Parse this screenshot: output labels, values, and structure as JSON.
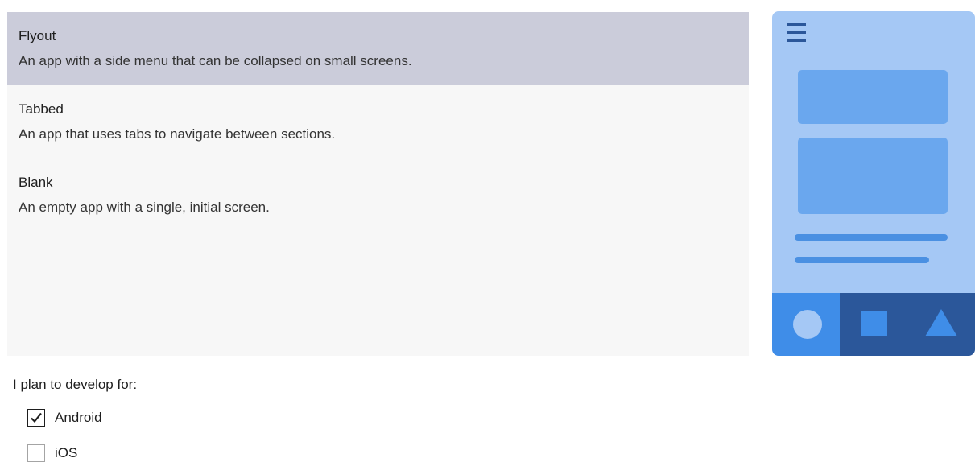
{
  "templates": [
    {
      "title": "Flyout",
      "description": "An app with a side menu that can be collapsed on small screens.",
      "selected": true
    },
    {
      "title": "Tabbed",
      "description": "An app that uses tabs to navigate between sections.",
      "selected": false
    },
    {
      "title": "Blank",
      "description": "An empty app with a single, initial screen.",
      "selected": false
    }
  ],
  "preview": {
    "icons": [
      "hamburger-menu-icon",
      "circle-tab-icon",
      "square-tab-icon",
      "triangle-tab-icon"
    ],
    "colors": {
      "background": "#a5c8f5",
      "card": "#6aa7ee",
      "accent": "#3f8de8",
      "dark": "#2b579a",
      "line": "#4a90e2"
    }
  },
  "platforms": {
    "label": "I plan to develop for:",
    "options": [
      {
        "label": "Android",
        "checked": true
      },
      {
        "label": "iOS",
        "checked": false
      }
    ]
  }
}
